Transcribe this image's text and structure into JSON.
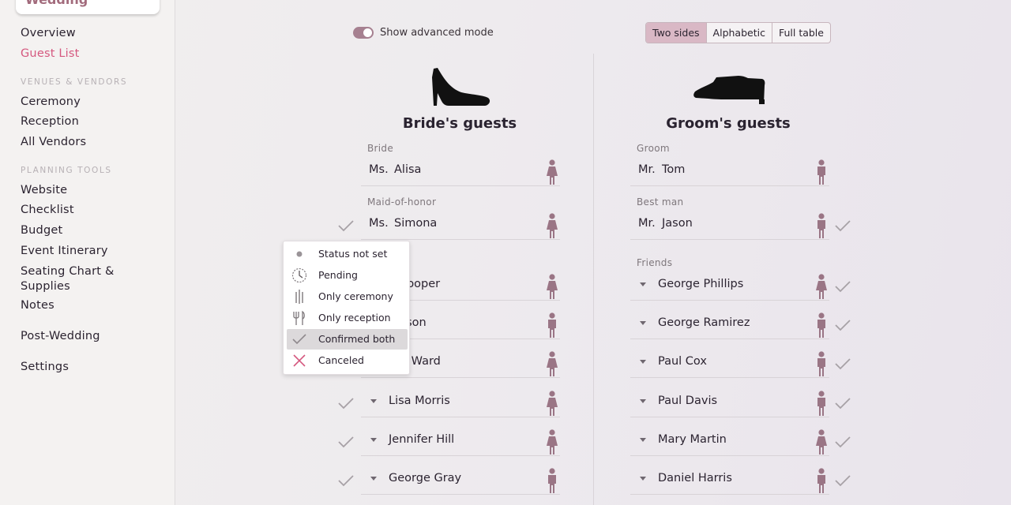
{
  "sidebar": {
    "logo_text": "Wedding",
    "items": [
      "Overview",
      "Guest List"
    ],
    "sections": [
      {
        "title": "VENUES & VENDORS",
        "items": [
          "Ceremony",
          "Reception",
          "All Vendors"
        ]
      },
      {
        "title": "PLANNING TOOLS",
        "items": [
          "Website",
          "Checklist",
          "Budget",
          "Event Itinerary",
          "Seating Chart & Supplies",
          "Notes"
        ]
      }
    ],
    "post_wedding": "Post-Wedding",
    "settings": "Settings",
    "active": "Guest List"
  },
  "toolbar": {
    "advanced_mode_label": "Show advanced mode",
    "advanced_mode_on": true,
    "view_options": [
      "Two sides",
      "Alphabetic",
      "Full table"
    ],
    "view_selected": "Two sides"
  },
  "bride": {
    "title": "Bride's guests",
    "bride_label": "Bride",
    "bride_title": "Ms.",
    "bride_name": "Alisa",
    "moh_label": "Maid-of-honor",
    "moh_title": "Ms.",
    "moh_name": "Simona",
    "guests": [
      {
        "name": "y Cooper",
        "gender": "female",
        "status": ""
      },
      {
        "name": "Wilson",
        "gender": "male",
        "status": ""
      },
      {
        "name": "dra Ward",
        "gender": "female",
        "status": ""
      },
      {
        "name": "Lisa Morris",
        "gender": "female",
        "status": "confirmed"
      },
      {
        "name": "Jennifer Hill",
        "gender": "female",
        "status": "confirmed"
      },
      {
        "name": "George Gray",
        "gender": "male",
        "status": "confirmed"
      }
    ]
  },
  "groom": {
    "title": "Groom's guests",
    "groom_label": "Groom",
    "groom_title": "Mr.",
    "groom_name": "Tom",
    "bestman_label": "Best man",
    "bestman_title": "Mr.",
    "bestman_name": "Jason",
    "group_label": "Friends",
    "guests": [
      {
        "name": "George Phillips",
        "gender": "female",
        "status": "confirmed"
      },
      {
        "name": "George Ramirez",
        "gender": "male",
        "status": "confirmed"
      },
      {
        "name": "Paul Cox",
        "gender": "male",
        "status": "confirmed"
      },
      {
        "name": "Paul Davis",
        "gender": "male",
        "status": "confirmed"
      },
      {
        "name": "Mary Martin",
        "gender": "female",
        "status": "confirmed"
      },
      {
        "name": "Daniel Harris",
        "gender": "male",
        "status": "confirmed"
      }
    ]
  },
  "status_menu": {
    "items": [
      {
        "label": "Status not set",
        "icon": "dot-icon"
      },
      {
        "label": "Pending",
        "icon": "clock-icon"
      },
      {
        "label": "Only ceremony",
        "icon": "candles-icon"
      },
      {
        "label": "Only reception",
        "icon": "fork-knife-icon"
      },
      {
        "label": "Confirmed both",
        "icon": "check-icon"
      },
      {
        "label": "Canceled",
        "icon": "cross-icon"
      }
    ],
    "selected": "Confirmed both"
  },
  "colors": {
    "accent": "#d5587f",
    "gender_icon": "#9a7585",
    "check": "#a7a1a6",
    "cancel": "#d5587f"
  }
}
